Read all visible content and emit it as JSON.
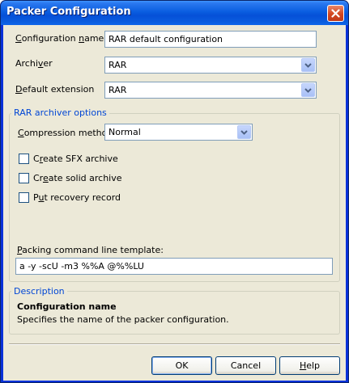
{
  "window": {
    "title": "Packer Configuration",
    "close_icon": "close-icon"
  },
  "form": {
    "config_name_label": "Configuration name",
    "config_name_value": "RAR default configuration",
    "archiver_label": "Archiver",
    "archiver_value": "RAR",
    "default_ext_label": "Default extension",
    "default_ext_value": "RAR"
  },
  "rar_options": {
    "title": "RAR archiver options",
    "compression_label": "Compression method:",
    "compression_value": "Normal",
    "sfx_label": "Create SFX archive",
    "sfx_checked": false,
    "solid_label": "Create solid archive",
    "solid_checked": false,
    "recovery_label": "Put recovery record",
    "recovery_checked": false,
    "template_label": "Packing command line template:",
    "template_value": "a -y -scU -m3 %%A @%%LU"
  },
  "description": {
    "title": "Description",
    "heading": "Configuration name",
    "text": "Specifies the name of the packer configuration."
  },
  "buttons": {
    "ok": "OK",
    "cancel": "Cancel",
    "help": "Help"
  },
  "colors": {
    "title_bar": "#0a5ee0",
    "dialog_face": "#ece9d8",
    "group_title": "#0046d5",
    "close_button": "#d2461f"
  }
}
